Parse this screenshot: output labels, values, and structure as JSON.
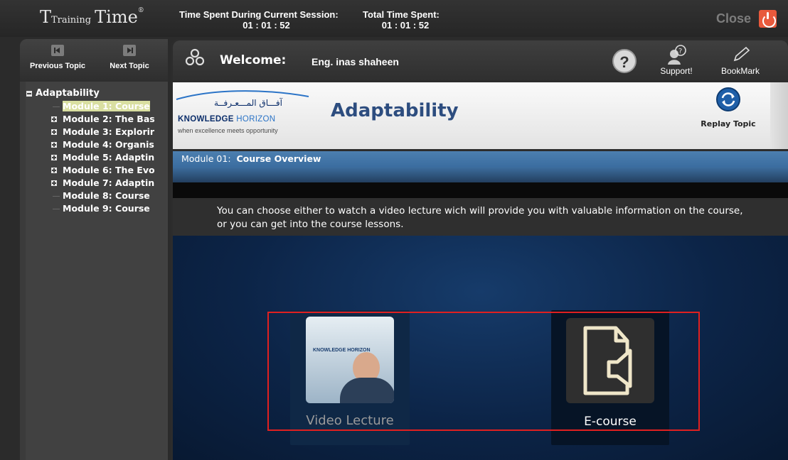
{
  "app": {
    "logo_training": "Training",
    "logo_time": "Time",
    "logo_reg": "®"
  },
  "timer": {
    "current_label": "Time Spent During Current Session:",
    "current_value": "01 : 01 : 52",
    "total_label": "Total Time Spent:",
    "total_value": "01 : 01 : 52"
  },
  "close_label": "Close",
  "topic_nav": {
    "previous_label": "Previous Topic",
    "next_label": "Next Topic"
  },
  "tree": {
    "root_label": "Adaptability",
    "items": [
      {
        "label": "Module 1: Course",
        "active": true,
        "expandable": false
      },
      {
        "label": "Module 2: The Bas",
        "active": false,
        "expandable": true
      },
      {
        "label": "Module 3: Explorir",
        "active": false,
        "expandable": true
      },
      {
        "label": "Module 4: Organis",
        "active": false,
        "expandable": true
      },
      {
        "label": "Module 5: Adaptin",
        "active": false,
        "expandable": true
      },
      {
        "label": "Module 6: The Evo",
        "active": false,
        "expandable": true
      },
      {
        "label": "Module 7: Adaptin",
        "active": false,
        "expandable": true
      },
      {
        "label": "Module 8: Course",
        "active": false,
        "expandable": false
      },
      {
        "label": "Module 9: Course",
        "active": false,
        "expandable": false
      }
    ]
  },
  "welcome": {
    "label": "Welcome:",
    "user": "Eng. inas shaheen",
    "help_label": "?",
    "support_label": "Support!",
    "bookmark_label": "BookMark"
  },
  "course": {
    "logo_arabic": "آفـــاق المـــعـرفــة",
    "logo_name_bold": "KNOWLEDGE",
    "logo_name_light": "HORIZON",
    "logo_tagline": "when excellence meets opportunity",
    "title": "Adaptability",
    "replay_label": "Replay Topic"
  },
  "module": {
    "prefix": "Module 01:",
    "name": "Course Overview"
  },
  "intro_text": "You can choose either to watch a video lecture wich will provide you with valuable information on the course, or you can get into the course lessons.",
  "choices": {
    "video_label": "Video Lecture",
    "ecourse_label": "E-course",
    "thumb_logo": "KNOWLEDGE HORIZON"
  },
  "colors": {
    "accent_blue": "#2d4d7f",
    "highlight_active": "#d9dfa1",
    "selection_border": "#e02020",
    "close_icon": "#e8593c"
  }
}
